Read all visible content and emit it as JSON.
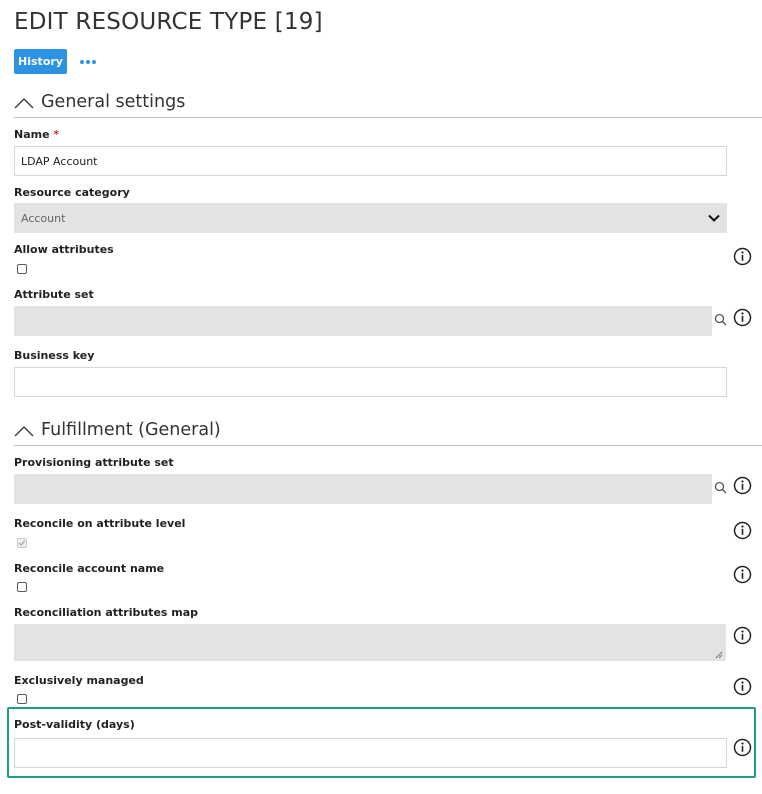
{
  "page": {
    "title": "EDIT RESOURCE TYPE [19]"
  },
  "toolbar": {
    "history_label": "History"
  },
  "sections": {
    "general": {
      "title": "General settings"
    },
    "fulfillment": {
      "title": "Fulfillment (General)"
    }
  },
  "fields": {
    "name": {
      "label": "Name",
      "required_mark": "*",
      "value": "LDAP Account"
    },
    "resource_category": {
      "label": "Resource category",
      "value": "Account"
    },
    "allow_attributes": {
      "label": "Allow attributes",
      "checked": false
    },
    "attribute_set": {
      "label": "Attribute set",
      "value": ""
    },
    "business_key": {
      "label": "Business key",
      "value": ""
    },
    "provisioning_attribute_set": {
      "label": "Provisioning attribute set",
      "value": ""
    },
    "reconcile_on_attribute_level": {
      "label": "Reconcile on attribute level",
      "checked": true,
      "disabled": true
    },
    "reconcile_account_name": {
      "label": "Reconcile account name",
      "checked": false
    },
    "reconciliation_attributes_map": {
      "label": "Reconciliation attributes map",
      "value": ""
    },
    "exclusively_managed": {
      "label": "Exclusively managed",
      "checked": false
    },
    "post_validity_days": {
      "label": "Post-validity (days)",
      "value": ""
    }
  },
  "colors": {
    "accent": "#2b92e4",
    "highlight": "#1f9e84",
    "required": "#c0392b",
    "disabled_bg": "#e3e3e3"
  }
}
